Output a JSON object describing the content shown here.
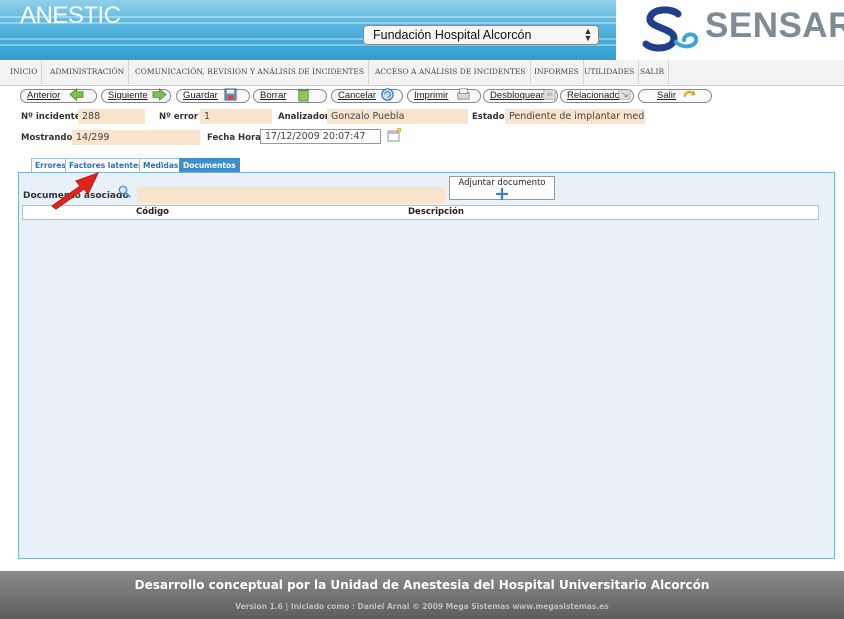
{
  "header": {
    "app_title": "ANESTIC",
    "hospital_select": "Fundación Hospital Alcorcón",
    "logo": "SENSAR",
    "accent_color": "#3aa6d8"
  },
  "menu": [
    "INICIO",
    "ADMINISTRACIÓN",
    "COMUNICACIÓN, REVISION Y ANÁLISIS DE INCIDENTES",
    "ACCESO A ANÁLISIS DE INCIDENTES",
    "INFORMES",
    "UTILIDADES",
    "SALIR"
  ],
  "toolbar": {
    "anterior": "Anterior",
    "siguiente": "Siguiente",
    "guardar": "Guardar",
    "borrar": "Borrar",
    "cancelar": "Cancelar",
    "imprimir": "Imprimir",
    "desbloquear": "Desbloquear",
    "relacionado": "Relacionado",
    "salir": "Salir"
  },
  "form": {
    "incidente_label": "Nº incidente",
    "incidente_value": "288",
    "error_label": "Nº error",
    "error_value": "1",
    "analizador_label": "Analizador",
    "analizador_value": "Gonzalo Puebla",
    "estado_label": "Estado",
    "estado_value": "Pendiente de implantar medi",
    "mostrando_label": "Mostrando",
    "mostrando_value": "14/299",
    "fecha_label": "Fecha Hora",
    "fecha_value": "17/12/2009 20:07:47"
  },
  "tabs": [
    "Errores",
    "Factores latentes",
    "Medidas",
    "Documentos"
  ],
  "active_tab": "Documentos",
  "documentos": {
    "asociado_label": "Documento asociado",
    "adjuntar_label": "Adjuntar documento",
    "columns": [
      "Código",
      "Descripción"
    ]
  },
  "footer": {
    "line1": "Desarrollo conceptual por la Unidad de Anestesia del Hospital Universitario Alcorcón",
    "line2": "Version 1.6 | Iniciado como : Daniel Arnal © 2009 Mega Sistemas www.megasistemas.es"
  }
}
